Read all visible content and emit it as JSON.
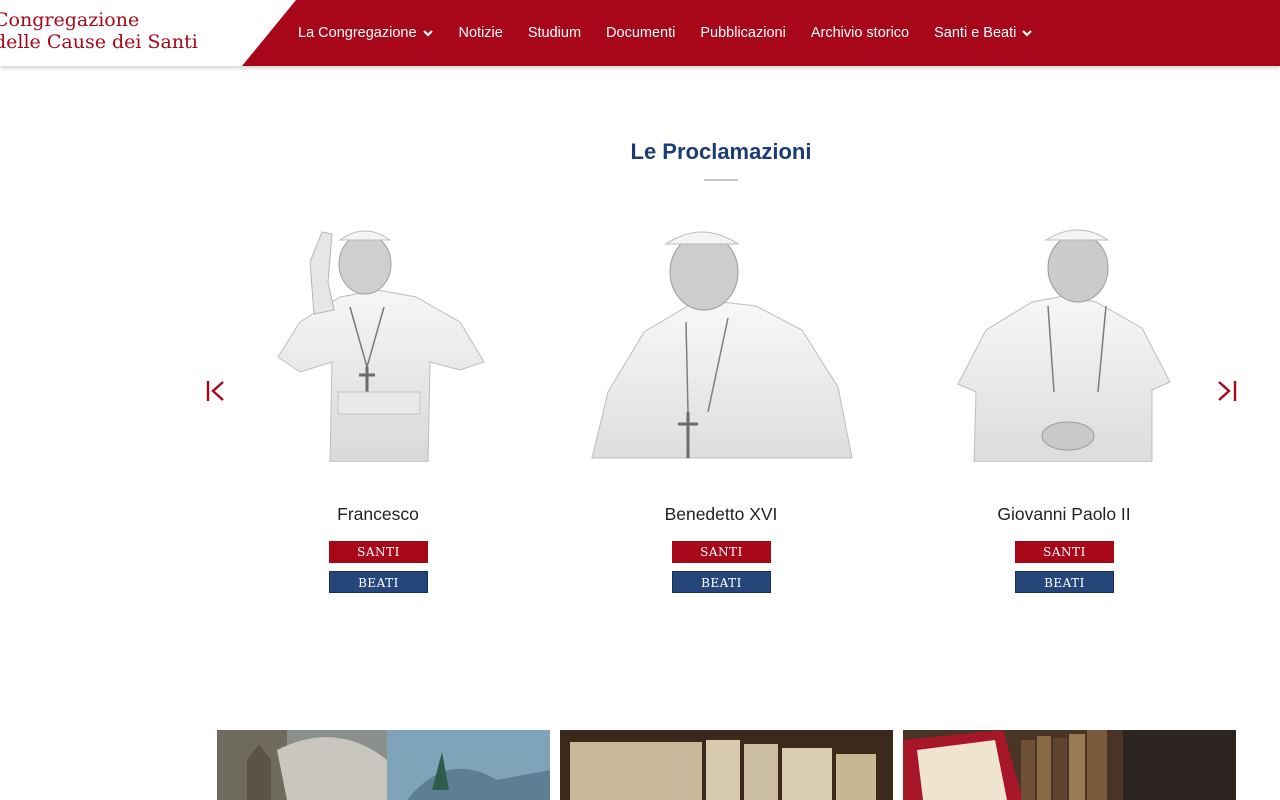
{
  "site": {
    "logo_line1": "Congregazione",
    "logo_line2": "delle Cause dei Santi"
  },
  "nav": {
    "items": [
      {
        "label": "La Congregazione",
        "has_dropdown": true
      },
      {
        "label": "Notizie",
        "has_dropdown": false
      },
      {
        "label": "Studium",
        "has_dropdown": false
      },
      {
        "label": "Documenti",
        "has_dropdown": false
      },
      {
        "label": "Pubblicazioni",
        "has_dropdown": false
      },
      {
        "label": "Archivio storico",
        "has_dropdown": false
      },
      {
        "label": "Santi e Beati",
        "has_dropdown": true
      }
    ]
  },
  "proclamazioni": {
    "title": "Le Proclamazioni",
    "popes": [
      {
        "name": "Francesco",
        "santi_label": "SANTI",
        "beati_label": "BEATI"
      },
      {
        "name": "Benedetto XVI",
        "santi_label": "SANTI",
        "beati_label": "BEATI"
      },
      {
        "name": "Giovanni Paolo II",
        "santi_label": "SANTI",
        "beati_label": "BEATI"
      }
    ],
    "prev_icon": "first-page-icon",
    "next_icon": "last-page-icon"
  },
  "colors": {
    "brand_red": "#a8071a",
    "brand_blue": "#24467a",
    "title_blue": "#1c3c74"
  }
}
